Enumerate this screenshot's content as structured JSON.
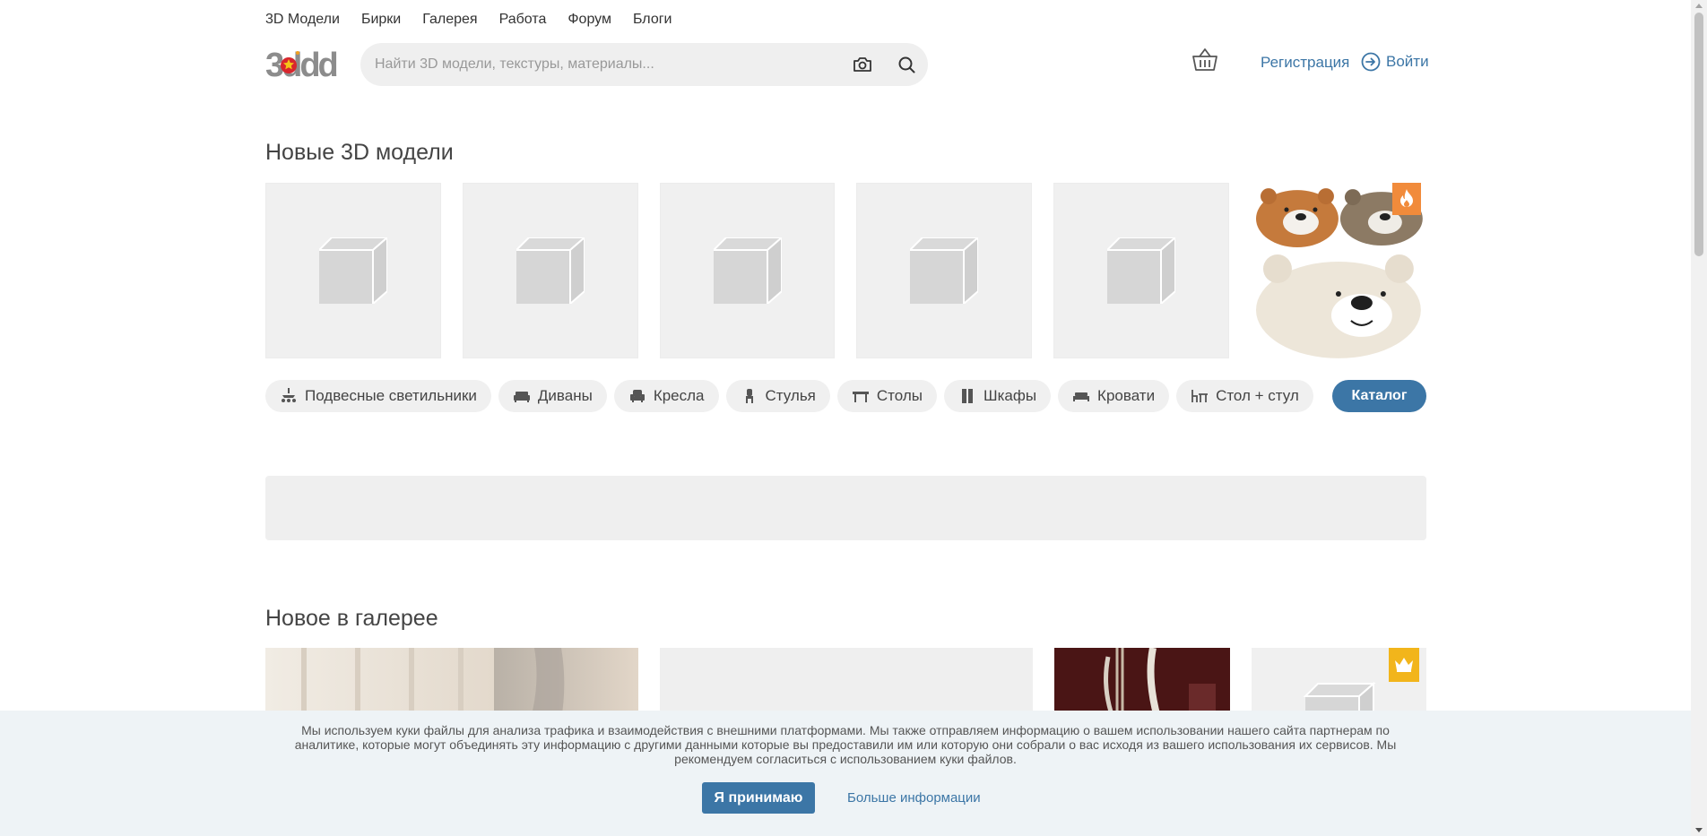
{
  "nav": {
    "items": [
      "3D Модели",
      "Бирки",
      "Галерея",
      "Работа",
      "Форум",
      "Блоги"
    ]
  },
  "header": {
    "logo_text": "3ddd",
    "search_placeholder": "Найти 3D модели, текстуры, материалы...",
    "register_label": "Регистрация",
    "login_label": "Войти"
  },
  "new_models": {
    "title": "Новые 3D модели",
    "featured_badge_icon": "fire-icon"
  },
  "categories": {
    "items": [
      {
        "label": "Подвесные светильники",
        "icon": "chandelier-icon"
      },
      {
        "label": "Диваны",
        "icon": "sofa-icon"
      },
      {
        "label": "Кресла",
        "icon": "armchair-icon"
      },
      {
        "label": "Стулья",
        "icon": "chair-icon"
      },
      {
        "label": "Столы",
        "icon": "table-icon"
      },
      {
        "label": "Шкафы",
        "icon": "wardrobe-icon"
      },
      {
        "label": "Кровати",
        "icon": "bed-icon"
      },
      {
        "label": "Стол + стул",
        "icon": "table-chair-icon"
      }
    ],
    "catalog_label": "Каталог"
  },
  "gallery": {
    "title": "Новое в галерее",
    "premium_icon": "crown-icon"
  },
  "cookie": {
    "text": "Мы используем куки файлы для анализа трафика и взаимодействия с внешними платформами. Мы также отправляем информацию о вашем использовании нашего сайта партнерам по аналитике, которые могут объединять эту информацию с другими данными которые вы предоставили им или которую они собрали о вас исходя из вашего использования их сервисов. Мы рекомендуем согласиться с использованием куки файлов.",
    "accept_label": "Я принимаю",
    "more_label": "Больше информации"
  },
  "colors": {
    "accent": "#3c76a6",
    "hot_badge": "#f18b3b",
    "crown_badge": "#f2b51b"
  }
}
